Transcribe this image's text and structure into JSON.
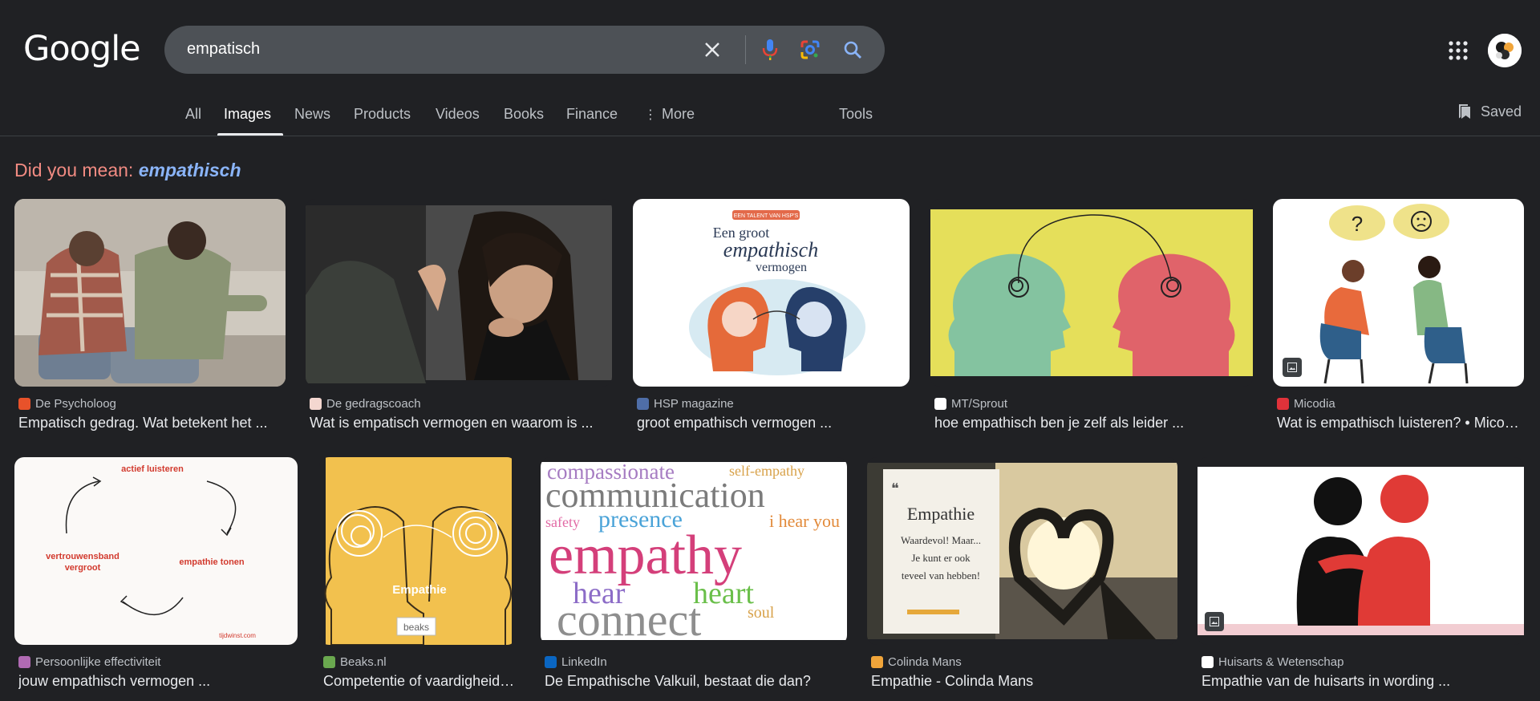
{
  "logo": "Google",
  "search": {
    "query": "empatisch"
  },
  "tabs": [
    "All",
    "Images",
    "News",
    "Products",
    "Videos",
    "Books",
    "Finance",
    "More",
    "Tools"
  ],
  "saved_label": "Saved",
  "did_you_mean": {
    "prefix": "Did you mean:",
    "suggestion": "empathisch"
  },
  "results": [
    {
      "source": "De Psycholoog",
      "title": "Empatisch gedrag. Wat betekent het ...",
      "favicon_color": "#e8522a"
    },
    {
      "source": "De gedragscoach",
      "title": "Wat is empatisch vermogen en waarom is ...",
      "favicon_color": "#f4d7d0"
    },
    {
      "source": "HSP magazine",
      "title": "groot empathisch vermogen ...",
      "favicon_color": "#4f6ea8"
    },
    {
      "source": "MT/Sprout",
      "title": "hoe empathisch ben je zelf als leider ...",
      "favicon_color": "#ffffff"
    },
    {
      "source": "Micodia",
      "title": "Wat is empathisch luisteren? • Micodia",
      "favicon_color": "#e0323a"
    },
    {
      "source": "Persoonlijke effectiviteit",
      "title": "jouw empathisch vermogen ...",
      "favicon_color": "#b06ab3"
    },
    {
      "source": "Beaks.nl",
      "title": "Competentie of vaardigheid ...",
      "favicon_color": "#6aa84f"
    },
    {
      "source": "LinkedIn",
      "title": "De Empathische Valkuil, bestaat die dan?",
      "favicon_color": "#0a66c2"
    },
    {
      "source": "Colinda Mans",
      "title": "Empathie - Colinda Mans",
      "favicon_color": "#f1a53a"
    },
    {
      "source": "Huisarts & Wetenschap",
      "title": "Empathie van de huisarts in wording ...",
      "favicon_color": "#ffffff"
    }
  ],
  "image_text": {
    "hsp_banner": "EEN TALENT VAN HSP'S",
    "hsp_line1": "Een groot",
    "hsp_line2": "empathisch",
    "hsp_line3": "vermogen",
    "cycle_top": "actief luisteren",
    "cycle_left1": "vertrouwensband",
    "cycle_left2": "vergroot",
    "cycle_right": "empathie tonen",
    "cycle_brand": "tijdwinst.com",
    "beaks_word": "Empathie",
    "beaks_logo": "beaks",
    "wc_compassionate": "compassionate",
    "wc_self": "self-empathy",
    "wc_communication": "communication",
    "wc_presence": "presence",
    "wc_hear_you": "i hear you",
    "wc_safety": "safety",
    "wc_empathy": "empathy",
    "wc_hear": "hear",
    "wc_heart": "heart",
    "wc_connect": "connect",
    "wc_soul": "soul",
    "colinda_title": "Empathie",
    "colinda_l1": "Waardevol! Maar...",
    "colinda_l2": "Je kunt er ook",
    "colinda_l3": "teveel van hebben!",
    "micodia_q": "?"
  }
}
